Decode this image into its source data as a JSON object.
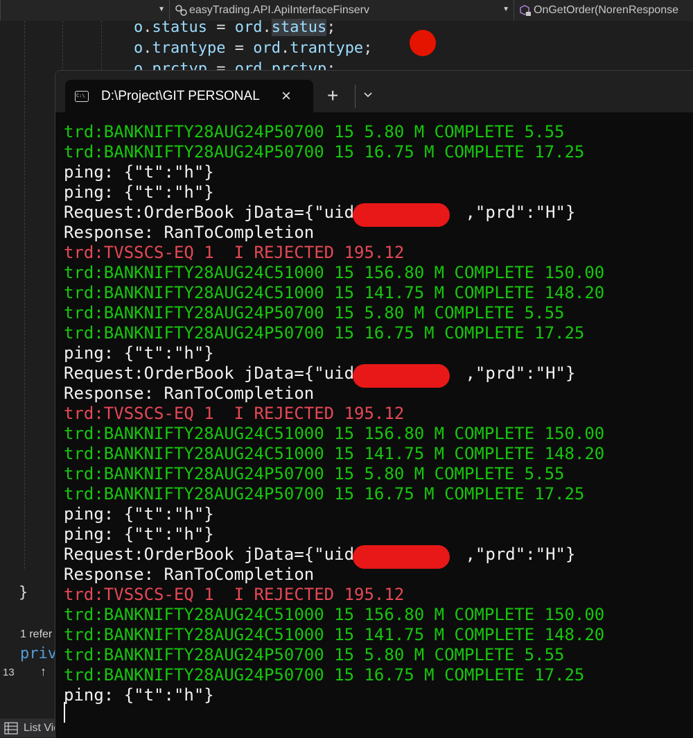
{
  "ide": {
    "nav_project": "easyTrading.API.ApiInterfaceFinserv",
    "nav_member": "OnGetOrder(NorenResponse",
    "code_lines": [
      {
        "obj": "o",
        "field": "status",
        "src": "ord",
        "srcfield": "status"
      },
      {
        "obj": "o",
        "field": "trantype",
        "src": "ord",
        "srcfield": "trantype"
      },
      {
        "obj": "o",
        "field": "prctyp",
        "src": "ord",
        "srcfield": "prctyp"
      }
    ],
    "closing_brace": "}",
    "reference_text": "1 refer",
    "private_kw": "priv",
    "line_count": "13",
    "bottom_tab": "List View",
    "breakpoint_color": "#e51400"
  },
  "terminal": {
    "tab_title": "D:\\Project\\GIT PERSONAL",
    "close_glyph": "×",
    "new_tab_glyph": "+",
    "colors": {
      "green": "#16c60c",
      "red": "#e74856",
      "white": "#f2f2f2",
      "redaction": "#e81818"
    },
    "lines": [
      {
        "color": "green",
        "text": "trd:BANKNIFTY28AUG24P50700 15 5.80 M COMPLETE 5.55"
      },
      {
        "color": "green",
        "text": "trd:BANKNIFTY28AUG24P50700 15 16.75 M COMPLETE 17.25"
      },
      {
        "color": "white",
        "text": "ping: {\"t\":\"h\"}"
      },
      {
        "color": "white",
        "text": "ping: {\"t\":\"h\"}"
      },
      {
        "color": "white",
        "text": "Request:OrderBook jData={\"uid\"",
        "suffix": ",\"prd\":\"H\"}",
        "redacted": true
      },
      {
        "color": "white",
        "text": "Response: RanToCompletion"
      },
      {
        "color": "red",
        "text": "trd:TVSSCS-EQ 1  I REJECTED 195.12"
      },
      {
        "color": "green",
        "text": "trd:BANKNIFTY28AUG24C51000 15 156.80 M COMPLETE 150.00"
      },
      {
        "color": "green",
        "text": "trd:BANKNIFTY28AUG24C51000 15 141.75 M COMPLETE 148.20"
      },
      {
        "color": "green",
        "text": "trd:BANKNIFTY28AUG24P50700 15 5.80 M COMPLETE 5.55"
      },
      {
        "color": "green",
        "text": "trd:BANKNIFTY28AUG24P50700 15 16.75 M COMPLETE 17.25"
      },
      {
        "color": "white",
        "text": "ping: {\"t\":\"h\"}"
      },
      {
        "color": "white",
        "text": "Request:OrderBook jData={\"uid\"",
        "suffix": ",\"prd\":\"H\"}",
        "redacted": true
      },
      {
        "color": "white",
        "text": "Response: RanToCompletion"
      },
      {
        "color": "red",
        "text": "trd:TVSSCS-EQ 1  I REJECTED 195.12"
      },
      {
        "color": "green",
        "text": "trd:BANKNIFTY28AUG24C51000 15 156.80 M COMPLETE 150.00"
      },
      {
        "color": "green",
        "text": "trd:BANKNIFTY28AUG24C51000 15 141.75 M COMPLETE 148.20"
      },
      {
        "color": "green",
        "text": "trd:BANKNIFTY28AUG24P50700 15 5.80 M COMPLETE 5.55"
      },
      {
        "color": "green",
        "text": "trd:BANKNIFTY28AUG24P50700 15 16.75 M COMPLETE 17.25"
      },
      {
        "color": "white",
        "text": "ping: {\"t\":\"h\"}"
      },
      {
        "color": "white",
        "text": "ping: {\"t\":\"h\"}"
      },
      {
        "color": "white",
        "text": "Request:OrderBook jData={\"uid\"",
        "suffix": ",\"prd\":\"H\"}",
        "redacted": true
      },
      {
        "color": "white",
        "text": "Response: RanToCompletion"
      },
      {
        "color": "red",
        "text": "trd:TVSSCS-EQ 1  I REJECTED 195.12"
      },
      {
        "color": "green",
        "text": "trd:BANKNIFTY28AUG24C51000 15 156.80 M COMPLETE 150.00"
      },
      {
        "color": "green",
        "text": "trd:BANKNIFTY28AUG24C51000 15 141.75 M COMPLETE 148.20"
      },
      {
        "color": "green",
        "text": "trd:BANKNIFTY28AUG24P50700 15 5.80 M COMPLETE 5.55"
      },
      {
        "color": "green",
        "text": "trd:BANKNIFTY28AUG24P50700 15 16.75 M COMPLETE 17.25"
      },
      {
        "color": "white",
        "text": "ping: {\"t\":\"h\"}"
      }
    ]
  }
}
